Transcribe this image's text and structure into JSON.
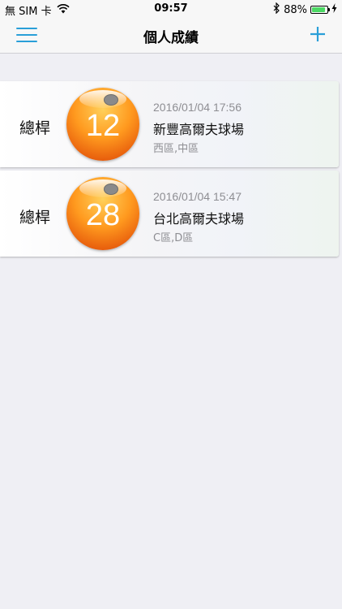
{
  "status_bar": {
    "carrier": "無 SIM 卡",
    "time": "09:57",
    "battery": "88%",
    "battery_level": 0.88
  },
  "nav": {
    "title": "個人成績",
    "menu_icon": "hamburger-menu-icon",
    "add_icon": "plus-icon",
    "accent": "#2a9fd8"
  },
  "rounds": [
    {
      "label": "總桿",
      "score": "12",
      "date": "2016/01/04 17:56",
      "course": "新豐高爾夫球場",
      "areas": "西區,中區"
    },
    {
      "label": "總桿",
      "score": "28",
      "date": "2016/01/04 15:47",
      "course": "台北高爾夫球場",
      "areas": "C區,D區"
    }
  ]
}
